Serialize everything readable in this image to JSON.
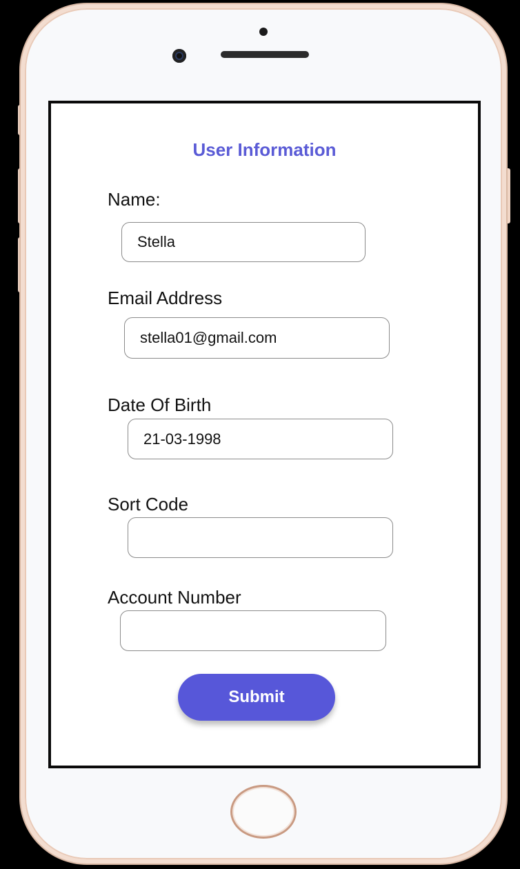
{
  "form": {
    "title": "User Information",
    "fields": [
      {
        "label": "Name:",
        "value": "Stella"
      },
      {
        "label": "Email Address",
        "value": "stella01@gmail.com"
      },
      {
        "label": "Date Of Birth",
        "value": "21-03-1998"
      },
      {
        "label": "Sort Code",
        "value": ""
      },
      {
        "label": "Account Number",
        "value": ""
      }
    ],
    "submit_label": "Submit"
  },
  "colors": {
    "accent": "#5757d9",
    "phone_frame": "#f3ddd0",
    "background": "#000000"
  }
}
